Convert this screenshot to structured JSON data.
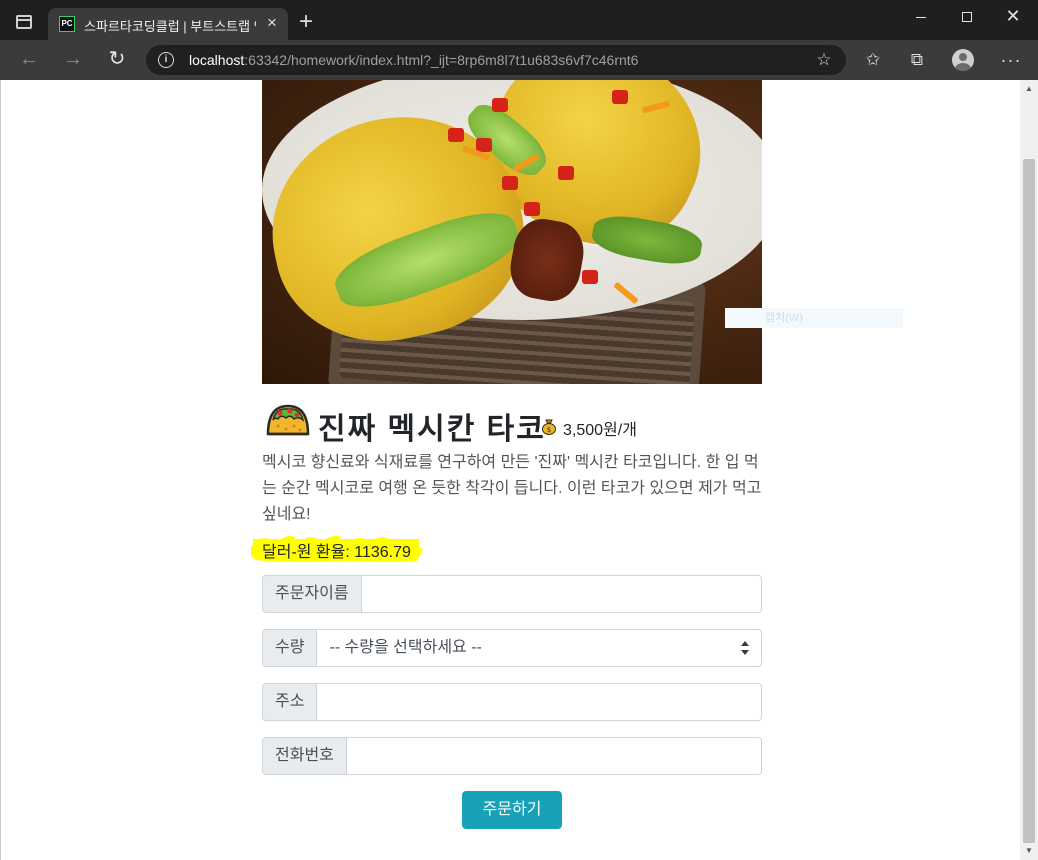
{
  "browser": {
    "tab_title": "스파르타코딩클럽 | 부트스트랩 연습",
    "favicon_text": "PC",
    "url_host": "localhost",
    "url_rest": ":63342/homework/index.html?_ijt=8rp6m8l7t1u683s6vf7c46rnt6"
  },
  "product": {
    "title": "진짜 멕시칸 타코",
    "price": "3,500원/개",
    "description": "멕시코 향신료와 식재료를 연구하여 만든 '진짜' 멕시칸 타코입니다. 한 입 먹는 순간 멕시코로 여행 온 듯한 착각이 듭니다. 이런 타코가 있으면 제가 먹고 싶네요!",
    "exchange_rate": "달러-원 환율: 1136.79"
  },
  "form": {
    "name_label": "주문자이름",
    "quantity_label": "수량",
    "quantity_selected": "-- 수량을 선택하세요 --",
    "address_label": "주소",
    "phone_label": "전화번호",
    "submit_label": "주문하기"
  },
  "overlay": {
    "ghost_text": "캡처(W)"
  },
  "colors": {
    "submit_button": "#17a2b8",
    "highlight": "#ffff00"
  },
  "icons": {
    "product_emoji": "taco-icon",
    "price_emoji": "money-bag-icon"
  }
}
